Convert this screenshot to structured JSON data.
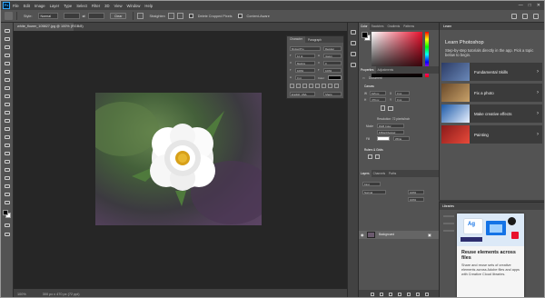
{
  "menubar": {
    "logo": "Ps",
    "items": [
      "File",
      "Edit",
      "Image",
      "Layer",
      "Type",
      "Select",
      "Filter",
      "3D",
      "View",
      "Window",
      "Help"
    ],
    "controls": [
      "—",
      "□",
      "✕"
    ]
  },
  "options": {
    "style_label": "Style:",
    "style_value": "Normal",
    "width_label": "Width:",
    "height_label": "Height:",
    "clear_label": "Clear",
    "straighten_label": "Straighten",
    "delete_cropped_label": "Delete Cropped Pixels",
    "content_aware_label": "Content-Aware"
  },
  "document": {
    "tab_label": "white_flower_105827.jpg @ 100% (RGB/8)",
    "status_zoom": "100%",
    "status_size": "300 px x 470 px (72 ppi)"
  },
  "character": {
    "tabs": [
      "Character",
      "Paragraph"
    ],
    "font_family": "Myriad Pro",
    "font_style": "Regular",
    "size": "12 pt",
    "leading": "(Auto)",
    "kerning": "Metrics",
    "tracking": "0",
    "vscale": "100%",
    "hscale": "100%",
    "baseline": "0 pt",
    "color_label": "Color:",
    "language": "English: USA",
    "antialias": "Sharp"
  },
  "color": {
    "tabs": [
      "Color",
      "Swatches",
      "Gradients",
      "Patterns"
    ],
    "fg": "#000000",
    "bg": "#ffffff",
    "hue_color": "#e8112d"
  },
  "properties": {
    "tabs": [
      "Properties",
      "Adjustments"
    ],
    "layer_type": "Document",
    "canvas_heading": "Canvas",
    "w_value": "615 px",
    "h_value": "479 px",
    "x_value": "0 px",
    "y_value": "0 px",
    "resolution": "Resolution: 72 pixels/inch",
    "mode_label": "Mode",
    "mode_value": "RGB Color",
    "depth_value": "8 Bits/Channel",
    "fill_label": "Fill",
    "fill_value": "White",
    "rulers_heading": "Rulers & Grids"
  },
  "layers": {
    "tabs": [
      "Layers",
      "Channels",
      "Paths"
    ],
    "kind_label": "Kind",
    "blend_mode": "Normal",
    "opacity": "100%",
    "fill": "100%",
    "layer_name": "Background"
  },
  "learn": {
    "tab": "Learn",
    "title": "Learn Photoshop",
    "description": "Step-by-step tutorials directly in the app. Pick a topic below to begin.",
    "items": [
      {
        "label": "Fundamental Skills",
        "color": "#3a4d7a"
      },
      {
        "label": "Fix a photo",
        "color": "#8c6a3c"
      },
      {
        "label": "Make creative effects",
        "color": "#2f6fb8"
      },
      {
        "label": "Painting",
        "color": "#b83030"
      }
    ]
  },
  "libraries": {
    "tab": "Libraries",
    "card_title": "Reuse elements across files",
    "card_desc": "Share and reuse sets of creative elements across Adobe files and apps with Creative Cloud libraries."
  }
}
